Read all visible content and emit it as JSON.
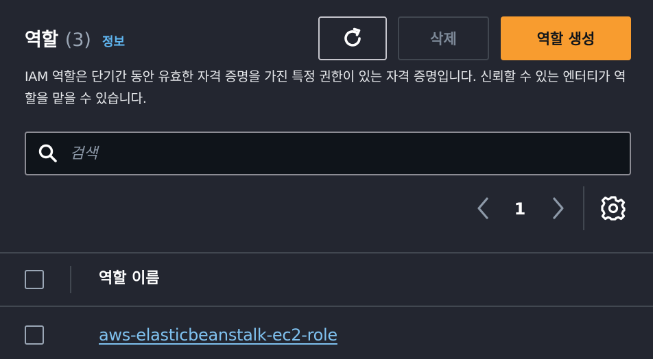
{
  "header": {
    "title": "역할",
    "count": "(3)",
    "info_link": "정보"
  },
  "buttons": {
    "refresh_icon": "refresh-icon",
    "delete_label": "삭제",
    "create_label": "역할 생성"
  },
  "description": "IAM 역할은 단기간 동안 유효한 자격 증명을 가진 특정 권한이 있는 자격 증명입니다. 신뢰할 수 있는 엔터티가 역할을 맡을 수 있습니다.",
  "search": {
    "placeholder": "검색",
    "value": ""
  },
  "pagination": {
    "current_page": "1"
  },
  "table": {
    "columns": [
      "역할 이름"
    ],
    "rows": [
      {
        "role_name": "aws-elasticbeanstalk-ec2-role"
      }
    ]
  },
  "colors": {
    "background": "#232630",
    "accent": "#f89c2f",
    "link": "#5fb5f0"
  }
}
